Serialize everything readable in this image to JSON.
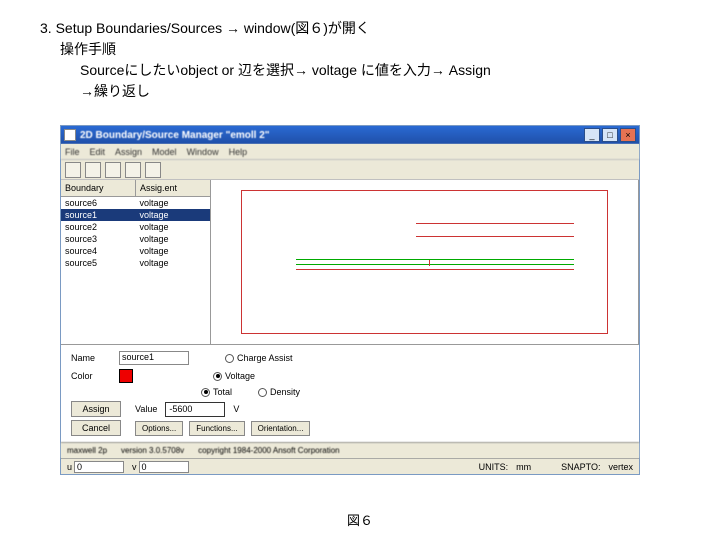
{
  "instructions": {
    "line1": "3. Setup Boundaries/Sources → window(図６)が開く",
    "line2": "操作手順",
    "line3": "Sourceにしたいobject or 辺を選択→ voltage に値を入力→ Assign",
    "line4": "→繰り返し"
  },
  "window": {
    "title": "2D Boundary/Source Manager \"emoll 2\"",
    "controls": {
      "min": "_",
      "max": "□",
      "close": "×"
    },
    "menu": [
      "File",
      "Edit",
      "Assign",
      "Model",
      "Window",
      "Help"
    ]
  },
  "left_panel": {
    "headers": [
      "Boundary",
      "Assig.ent"
    ],
    "rows": [
      {
        "name": "source6",
        "type": "voltage",
        "selected": false
      },
      {
        "name": "source1",
        "type": "voltage",
        "selected": true
      },
      {
        "name": "source2",
        "type": "voltage",
        "selected": false
      },
      {
        "name": "source3",
        "type": "voltage",
        "selected": false
      },
      {
        "name": "source4",
        "type": "voltage",
        "selected": false
      },
      {
        "name": "source5",
        "type": "voltage",
        "selected": false
      }
    ]
  },
  "form": {
    "name_label": "Name",
    "name_value": "source1",
    "color_label": "Color",
    "radio_charge": "Charge Assist",
    "radio_voltage": "Voltage",
    "radio_total": "Total",
    "radio_density": "Density",
    "assign_btn": "Assign",
    "cancel_btn": "Cancel",
    "value_label": "Value",
    "value": "-5600",
    "unit": "V",
    "options_btn": "Options...",
    "functions_btn": "Functions...",
    "orientation_btn": "Orientation..."
  },
  "status": {
    "app": "maxwell 2p",
    "version": "version 3.0.5708v",
    "copyright": "copyright 1984-2000 Ansoft Corporation",
    "units_label": "UNITS:",
    "units": "mm",
    "snap_label": "SNAPTO:",
    "snap": "vertex"
  },
  "coord": {
    "u_label": "u",
    "u_val": "0",
    "v_label": "v",
    "v_val": "0"
  },
  "caption": "図６"
}
